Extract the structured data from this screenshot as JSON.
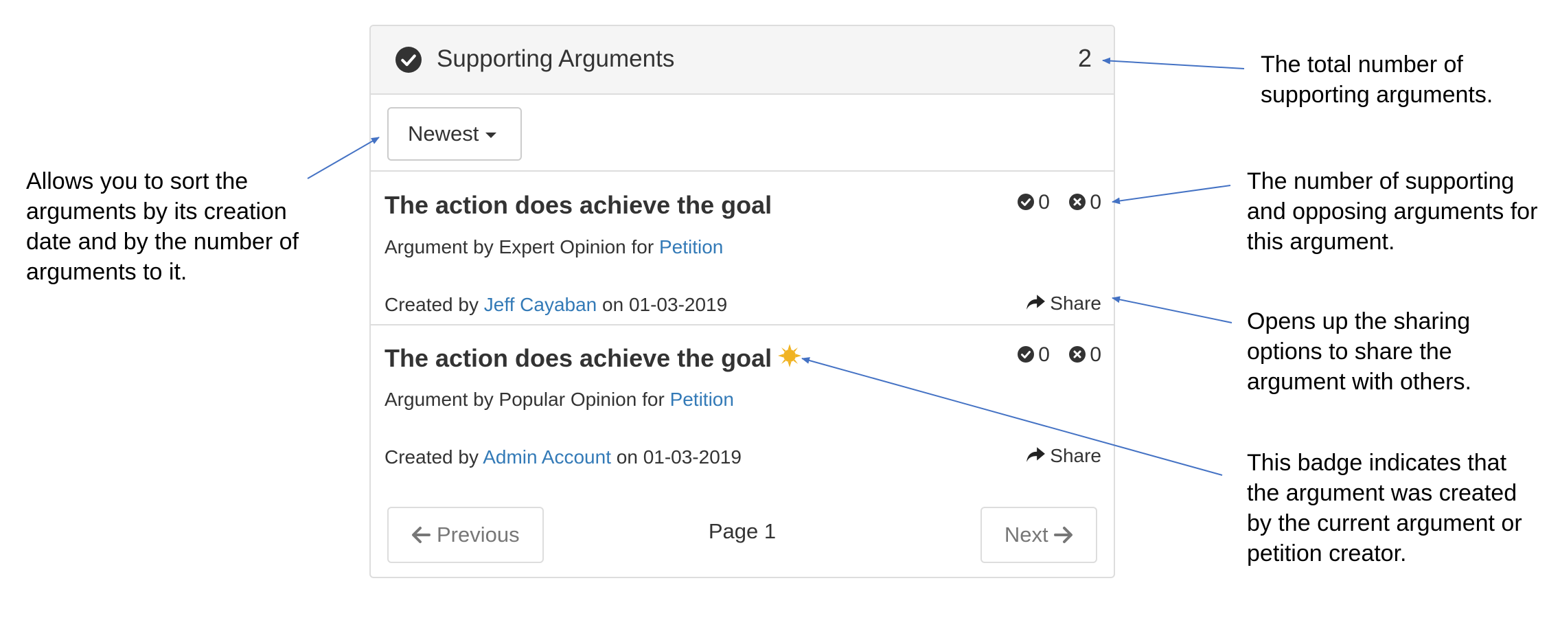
{
  "panel": {
    "title": "Supporting Arguments",
    "count": "2",
    "sort_label": "Newest",
    "arguments": [
      {
        "title": "The action does achieve the goal",
        "has_badge": false,
        "subtitle_prefix": "Argument by Expert Opinion for ",
        "subtitle_link": "Petition",
        "support_count": "0",
        "oppose_count": "0",
        "created_prefix": "Created by ",
        "creator": "Jeff Cayaban",
        "created_suffix": " on 01-03-2019",
        "share_label": "Share"
      },
      {
        "title": "The action does achieve the goal",
        "has_badge": true,
        "subtitle_prefix": "Argument by Popular Opinion for ",
        "subtitle_link": "Petition",
        "support_count": "0",
        "oppose_count": "0",
        "created_prefix": "Created by ",
        "creator": "Admin Account",
        "created_suffix": " on 01-03-2019",
        "share_label": "Share"
      }
    ],
    "pager": {
      "previous_label": "Previous",
      "page_label": "Page 1",
      "next_label": "Next"
    }
  },
  "annotations": {
    "total_count": "The total number of supporting arguments.",
    "sort": "Allows you to sort the arguments by its creation date and by the number of arguments to it.",
    "support_oppose": "The number of supporting and opposing arguments for this argument.",
    "share": "Opens up the sharing options to share the argument with others.",
    "badge": "This badge indicates that the argument was created by the current argument or petition creator."
  },
  "icons": {
    "heading": "check-circle-icon",
    "sort_caret": "caret-down-icon",
    "support": "check-circle-icon",
    "oppose": "times-circle-icon",
    "share": "share-arrow-icon",
    "badge": "sun-badge-icon",
    "previous": "arrow-left-icon",
    "next": "arrow-right-icon"
  },
  "colors": {
    "link": "#337ab7",
    "annotation_arrow": "#4472c4",
    "badge": "#f0b323",
    "heading_background": "#f5f5f5"
  }
}
